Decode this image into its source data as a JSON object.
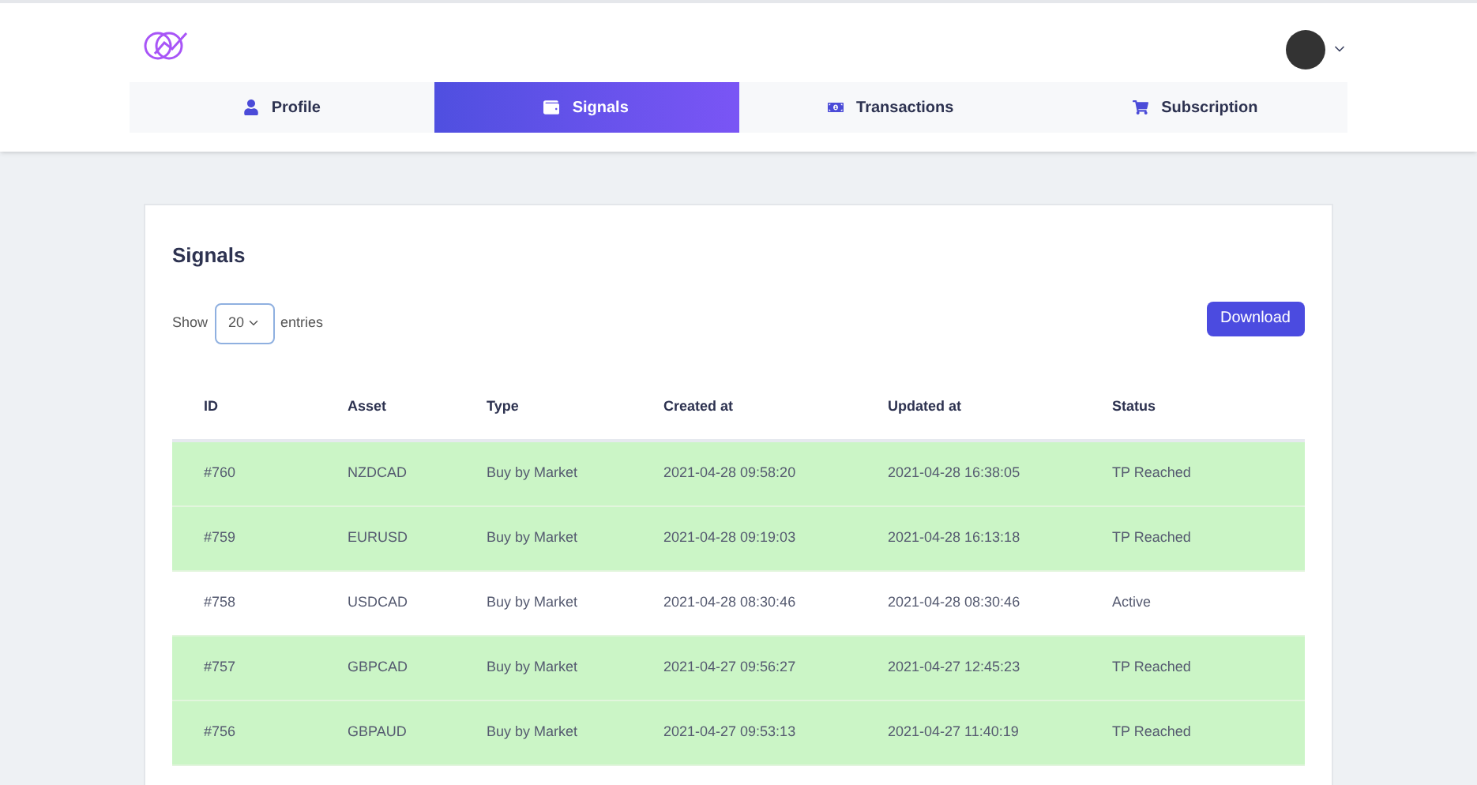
{
  "tabs": [
    {
      "label": "Profile",
      "kind": "user",
      "selected": false
    },
    {
      "label": "Signals",
      "kind": "wallet",
      "selected": true
    },
    {
      "label": "Transactions",
      "kind": "cash",
      "selected": false
    },
    {
      "label": "Subscription",
      "kind": "cart",
      "selected": false
    }
  ],
  "card": {
    "title": "Signals",
    "show_label": "Show",
    "entries_value": "20",
    "entries_label": "entries",
    "download": "Download"
  },
  "table": {
    "columns": [
      "ID",
      "Asset",
      "Type",
      "Created at",
      "Updated at",
      "Status"
    ],
    "rows": [
      {
        "cells": [
          "#760",
          "NZDCAD",
          "Buy by Market",
          "2021-04-28 09:58:20",
          "2021-04-28 16:38:05",
          "TP Reached"
        ],
        "highlighted": true
      },
      {
        "cells": [
          "#759",
          "EURUSD",
          "Buy by Market",
          "2021-04-28 09:19:03",
          "2021-04-28 16:13:18",
          "TP Reached"
        ],
        "highlighted": true
      },
      {
        "cells": [
          "#758",
          "USDCAD",
          "Buy by Market",
          "2021-04-28 08:30:46",
          "2021-04-28 08:30:46",
          "Active"
        ],
        "highlighted": false
      },
      {
        "cells": [
          "#757",
          "GBPCAD",
          "Buy by Market",
          "2021-04-27 09:56:27",
          "2021-04-27 12:45:23",
          "TP Reached"
        ],
        "highlighted": true
      },
      {
        "cells": [
          "#756",
          "GBPAUD",
          "Buy by Market",
          "2021-04-27 09:53:13",
          "2021-04-27 11:40:19",
          "TP Reached"
        ],
        "highlighted": true
      }
    ]
  }
}
